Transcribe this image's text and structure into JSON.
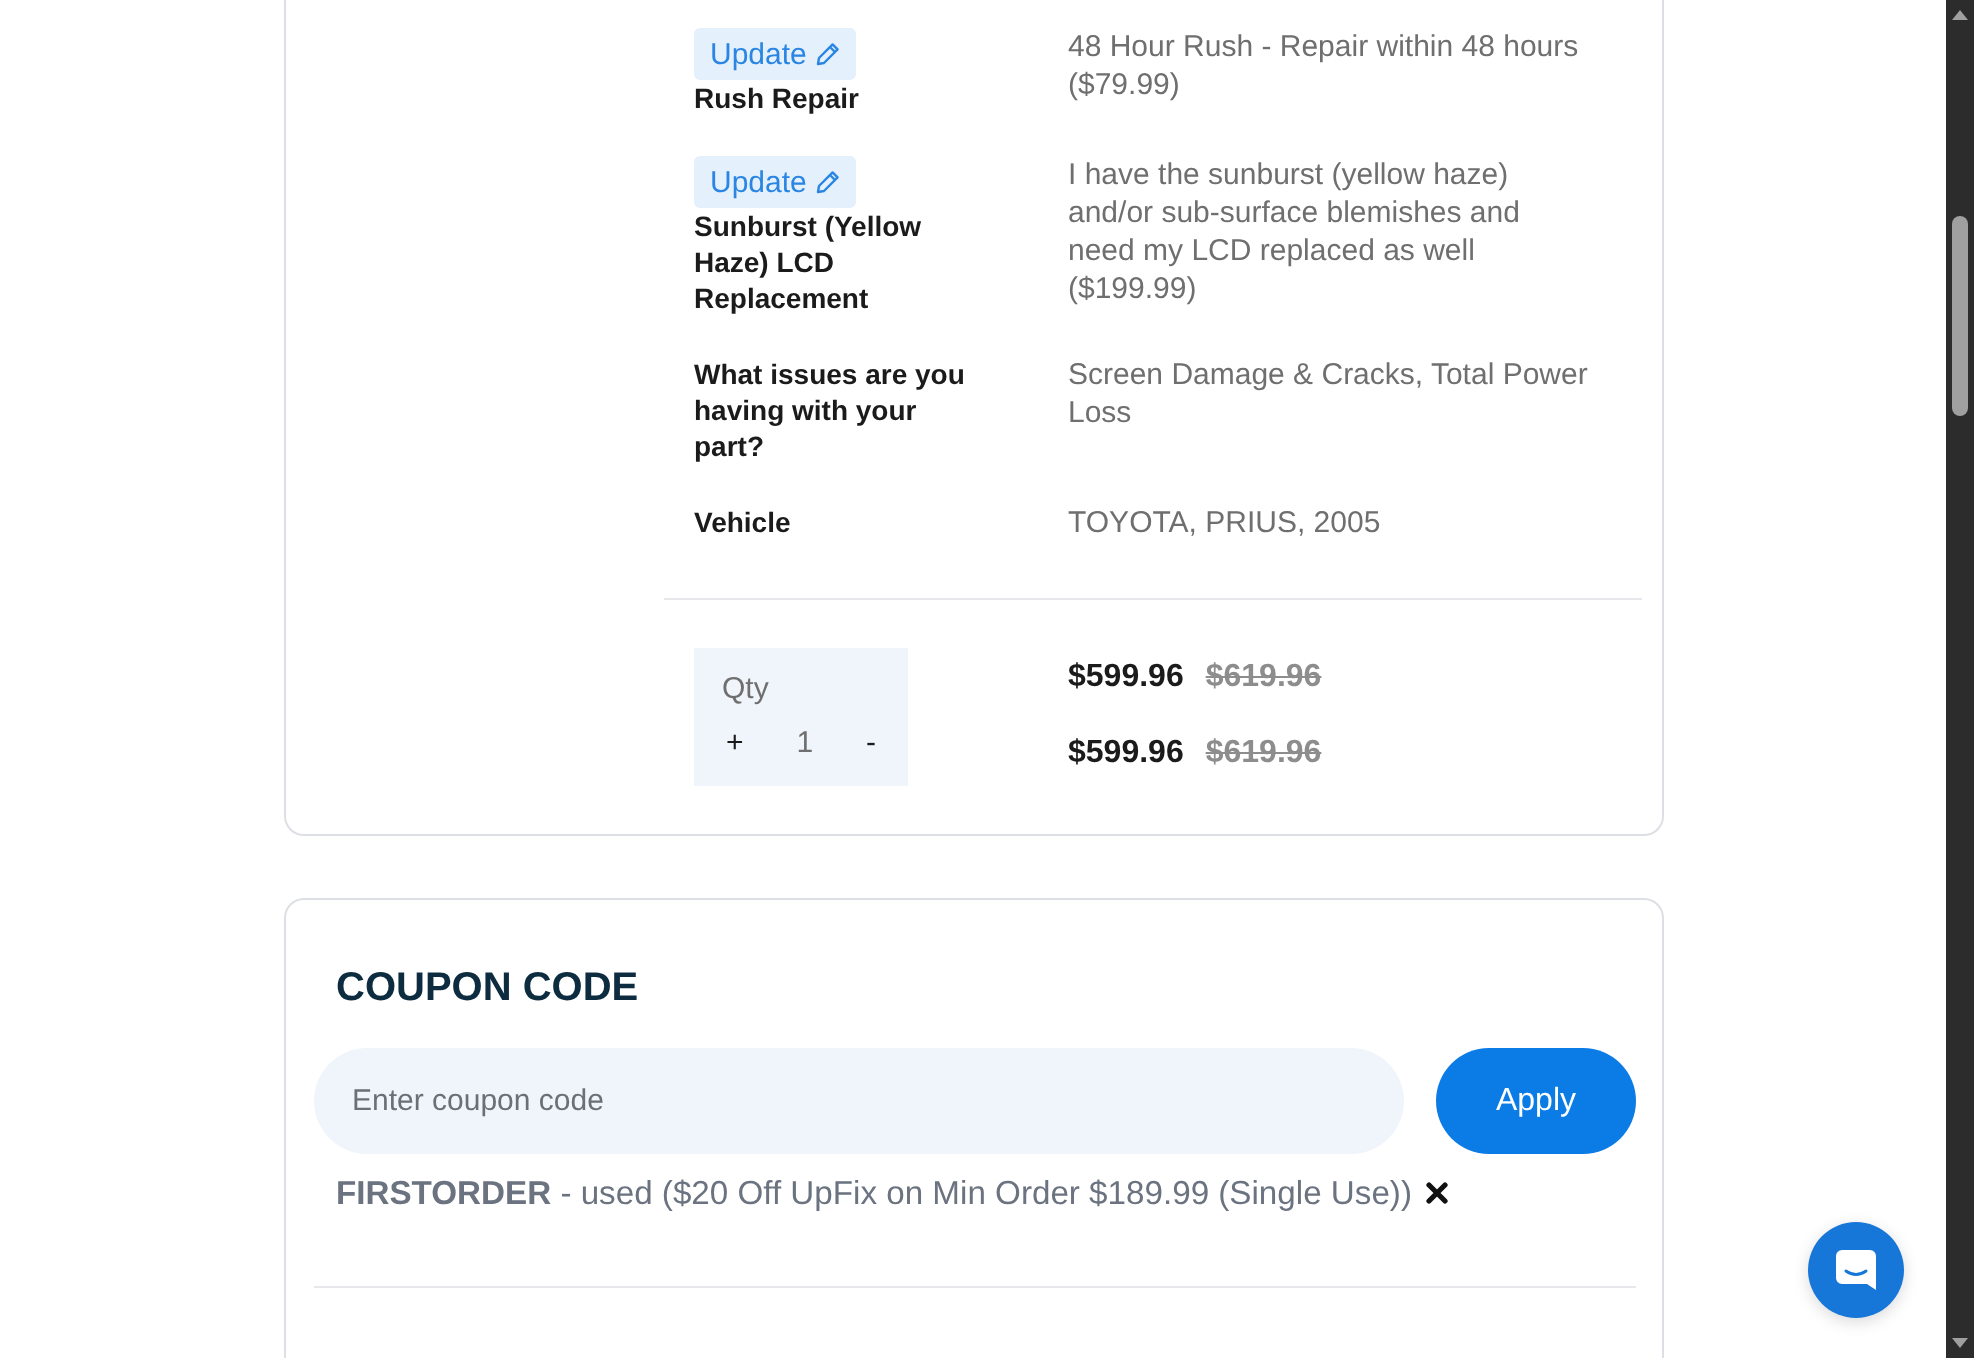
{
  "order_details": {
    "rows": [
      {
        "kind": "option",
        "action": "Update",
        "label": "Rush Repair",
        "value": "48 Hour Rush - Repair within 48 hours ($79.99)"
      },
      {
        "kind": "option",
        "action": "Update",
        "label": "Sunburst (Yellow Haze) LCD Replacement",
        "value": "I have the sunburst (yellow haze) and/or sub-surface blemishes and need my LCD replaced as well ($199.99)"
      },
      {
        "kind": "info",
        "label": "What issues are you having with your part?",
        "value": "Screen Damage & Cracks, Total Power Loss"
      },
      {
        "kind": "info",
        "label": "Vehicle",
        "value": "TOYOTA, PRIUS, 2005"
      }
    ],
    "quantity": {
      "label": "Qty",
      "increment": "+",
      "value": "1",
      "decrement": "-"
    },
    "prices": [
      {
        "price": "$599.96",
        "original_price": "$619.96"
      },
      {
        "price": "$599.96",
        "original_price": "$619.96"
      }
    ]
  },
  "coupon": {
    "title": "COUPON CODE",
    "placeholder": "Enter coupon code",
    "button": "Apply",
    "applied_coupon": {
      "code": "FIRSTORDER",
      "details": "- used ($20 Off UpFix on Min Order $189.99 (Single Use))"
    }
  }
}
